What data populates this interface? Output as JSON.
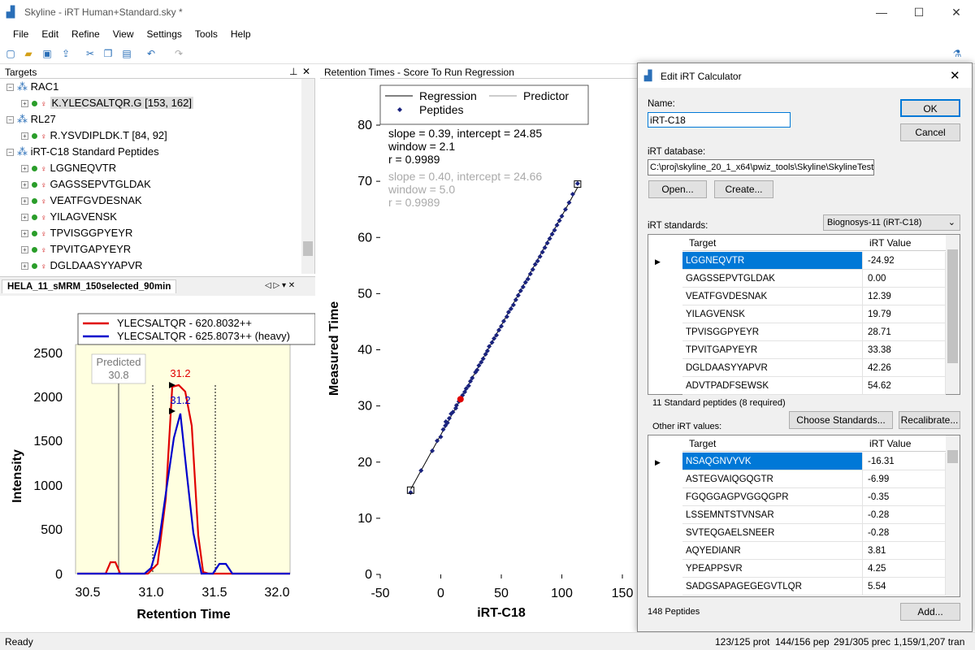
{
  "window": {
    "title": "Skyline - iRT Human+Standard.sky *",
    "min": "—",
    "max": "☐",
    "close": "✕"
  },
  "menu": [
    "File",
    "Edit",
    "Refine",
    "View",
    "Settings",
    "Tools",
    "Help"
  ],
  "targets": {
    "title": "Targets",
    "rows": [
      {
        "text": "RAC1",
        "level": 0
      },
      {
        "text": "K.YLECSALTQR.G [153, 162]",
        "level": 1
      },
      {
        "text": "RL27",
        "level": 0
      },
      {
        "text": "R.YSVDIPLDK.T [84, 92]",
        "level": 1
      },
      {
        "text": "iRT-C18 Standard Peptides",
        "level": 0
      },
      {
        "text": "LGGNEQVTR",
        "level": 1
      },
      {
        "text": "GAGSSEPVTGLDAK",
        "level": 1
      },
      {
        "text": "VEATFGVDESNAK",
        "level": 1
      },
      {
        "text": "YILAGVENSK",
        "level": 1
      },
      {
        "text": "TPVISGGPYEYR",
        "level": 1
      },
      {
        "text": "TPVITGAPYEYR",
        "level": 1
      },
      {
        "text": "DGLDAASYYAPVR",
        "level": 1
      }
    ]
  },
  "chrom": {
    "tab": "HELA_11_sMRM_150selected_90min",
    "legend": [
      "YLECSALTQR - 620.8032++",
      "YLECSALTQR - 625.8073++ (heavy)"
    ],
    "colors": [
      "#e00000",
      "#0000cc"
    ],
    "predicted_label": "Predicted",
    "predicted_value": "30.8",
    "peak_red": "31.2",
    "peak_blue": "31.2",
    "xlabel": "Retention Time",
    "ylabel": "Intensity",
    "yticks": [
      "0",
      "500",
      "1000",
      "1500",
      "2000",
      "2500"
    ],
    "xticks": [
      "30.5",
      "31.0",
      "31.5",
      "32.0"
    ]
  },
  "chart_data": {
    "type": "scatter",
    "title": "Retention Times - Score To Run Regression",
    "xlabel": "iRT-C18",
    "ylabel": "Measured Time",
    "xlim": [
      -50,
      150
    ],
    "ylim": [
      0,
      80
    ],
    "xticks": [
      "-50",
      "0",
      "50",
      "100",
      "150"
    ],
    "yticks": [
      "0",
      "10",
      "20",
      "30",
      "40",
      "50",
      "60",
      "70",
      "80"
    ],
    "legend": [
      "Regression",
      "Predictor",
      "Peptides"
    ],
    "stats1": [
      "slope = 0.39, intercept = 24.85",
      "window = 2.1",
      "r = 0.9989"
    ],
    "stats2": [
      "slope = 0.40, intercept = 24.66",
      "window = 5.0",
      "r = 0.9989"
    ],
    "regression": {
      "slope": 0.39,
      "intercept": 24.85,
      "x": [
        -24.92,
        113
      ]
    },
    "endpoints": [
      [
        -24.92,
        15.0
      ],
      [
        113,
        69.5
      ]
    ],
    "highlight": [
      16.3,
      31.2
    ],
    "points": [
      [
        -24.9,
        14.6
      ],
      [
        -16.3,
        18.5
      ],
      [
        -7,
        22
      ],
      [
        -3,
        23.8
      ],
      [
        0,
        24.5
      ],
      [
        2,
        25.8
      ],
      [
        3.8,
        26.5
      ],
      [
        4.2,
        27.2
      ],
      [
        5.5,
        27.0
      ],
      [
        7,
        27.8
      ],
      [
        8.5,
        28.6
      ],
      [
        10,
        28.9
      ],
      [
        12.4,
        29.6
      ],
      [
        13,
        30.1
      ],
      [
        15,
        30.8
      ],
      [
        16.5,
        31.4
      ],
      [
        18,
        31.9
      ],
      [
        19.8,
        32.5
      ],
      [
        21,
        33.1
      ],
      [
        23,
        33.6
      ],
      [
        24.5,
        34.4
      ],
      [
        26,
        35.0
      ],
      [
        28.7,
        36.0
      ],
      [
        30,
        36.4
      ],
      [
        31.5,
        37.2
      ],
      [
        33.4,
        37.8
      ],
      [
        35,
        38.4
      ],
      [
        37,
        39.2
      ],
      [
        38.5,
        39.8
      ],
      [
        40,
        40.6
      ],
      [
        42.3,
        41.3
      ],
      [
        44,
        42.0
      ],
      [
        46,
        42.6
      ],
      [
        48,
        43.5
      ],
      [
        50,
        44.2
      ],
      [
        52,
        45.1
      ],
      [
        54.6,
        45.9
      ],
      [
        56,
        46.7
      ],
      [
        58,
        47.3
      ],
      [
        60,
        48.0
      ],
      [
        62,
        48.9
      ],
      [
        64,
        49.7
      ],
      [
        66,
        50.5
      ],
      [
        68,
        51.2
      ],
      [
        70,
        52.0
      ],
      [
        72,
        52.6
      ],
      [
        74,
        53.5
      ],
      [
        76,
        54.3
      ],
      [
        78,
        55.2
      ],
      [
        80,
        55.8
      ],
      [
        82,
        56.6
      ],
      [
        84,
        57.4
      ],
      [
        86,
        58.2
      ],
      [
        88,
        59.0
      ],
      [
        90,
        59.8
      ],
      [
        92,
        60.6
      ],
      [
        94,
        61.3
      ],
      [
        96,
        62.2
      ],
      [
        98,
        63.0
      ],
      [
        100,
        63.8
      ],
      [
        103,
        65.0
      ],
      [
        106,
        66.2
      ],
      [
        109,
        67.7
      ],
      [
        113,
        69.6
      ]
    ]
  },
  "dialog": {
    "title": "Edit iRT Calculator",
    "name_label": "Name:",
    "name_value": "iRT-C18",
    "ok": "OK",
    "cancel": "Cancel",
    "db_label": "iRT database:",
    "db_value": "C:\\proj\\skyline_20_1_x64\\pwiz_tools\\Skyline\\SkylineTest",
    "open": "Open...",
    "create": "Create...",
    "standards_label": "iRT standards:",
    "standards_select": "Biognosys-11 (iRT-C18)",
    "col_target": "Target",
    "col_irt": "iRT Value",
    "standards": [
      [
        "LGGNEQVTR",
        "-24.92"
      ],
      [
        "GAGSSEPVTGLDAK",
        "0.00"
      ],
      [
        "VEATFGVDESNAK",
        "12.39"
      ],
      [
        "YILAGVENSK",
        "19.79"
      ],
      [
        "TPVISGGPYEYR",
        "28.71"
      ],
      [
        "TPVITGAPYEYR",
        "33.38"
      ],
      [
        "DGLDAASYYAPVR",
        "42.26"
      ],
      [
        "ADVTPADFSEWSK",
        "54.62"
      ]
    ],
    "standards_count": "11 Standard peptides (8 required)",
    "choose": "Choose Standards...",
    "recalibrate": "Recalibrate...",
    "other_label": "Other iRT values:",
    "others": [
      [
        "NSAQGNVYVK",
        "-16.31"
      ],
      [
        "ASTEGVAIQGQGTR",
        "-6.99"
      ],
      [
        "FGQGGAGPVGGQGPR",
        "-0.35"
      ],
      [
        "LSSEMNTSTVNSAR",
        "-0.28"
      ],
      [
        "SVTEQGAELSNEER",
        "-0.28"
      ],
      [
        "AQYEDIANR",
        "3.81"
      ],
      [
        "YPEAPPSVR",
        "4.25"
      ],
      [
        "SADGSAPAGEGEGVTLQR",
        "5.54"
      ]
    ],
    "peptides_count": "148 Peptides",
    "add": "Add..."
  },
  "status": {
    "ready": "Ready",
    "prot": "123/125 prot",
    "pep": "144/156 pep",
    "prec": "291/305 prec",
    "tran": "1,159/1,207 tran"
  }
}
